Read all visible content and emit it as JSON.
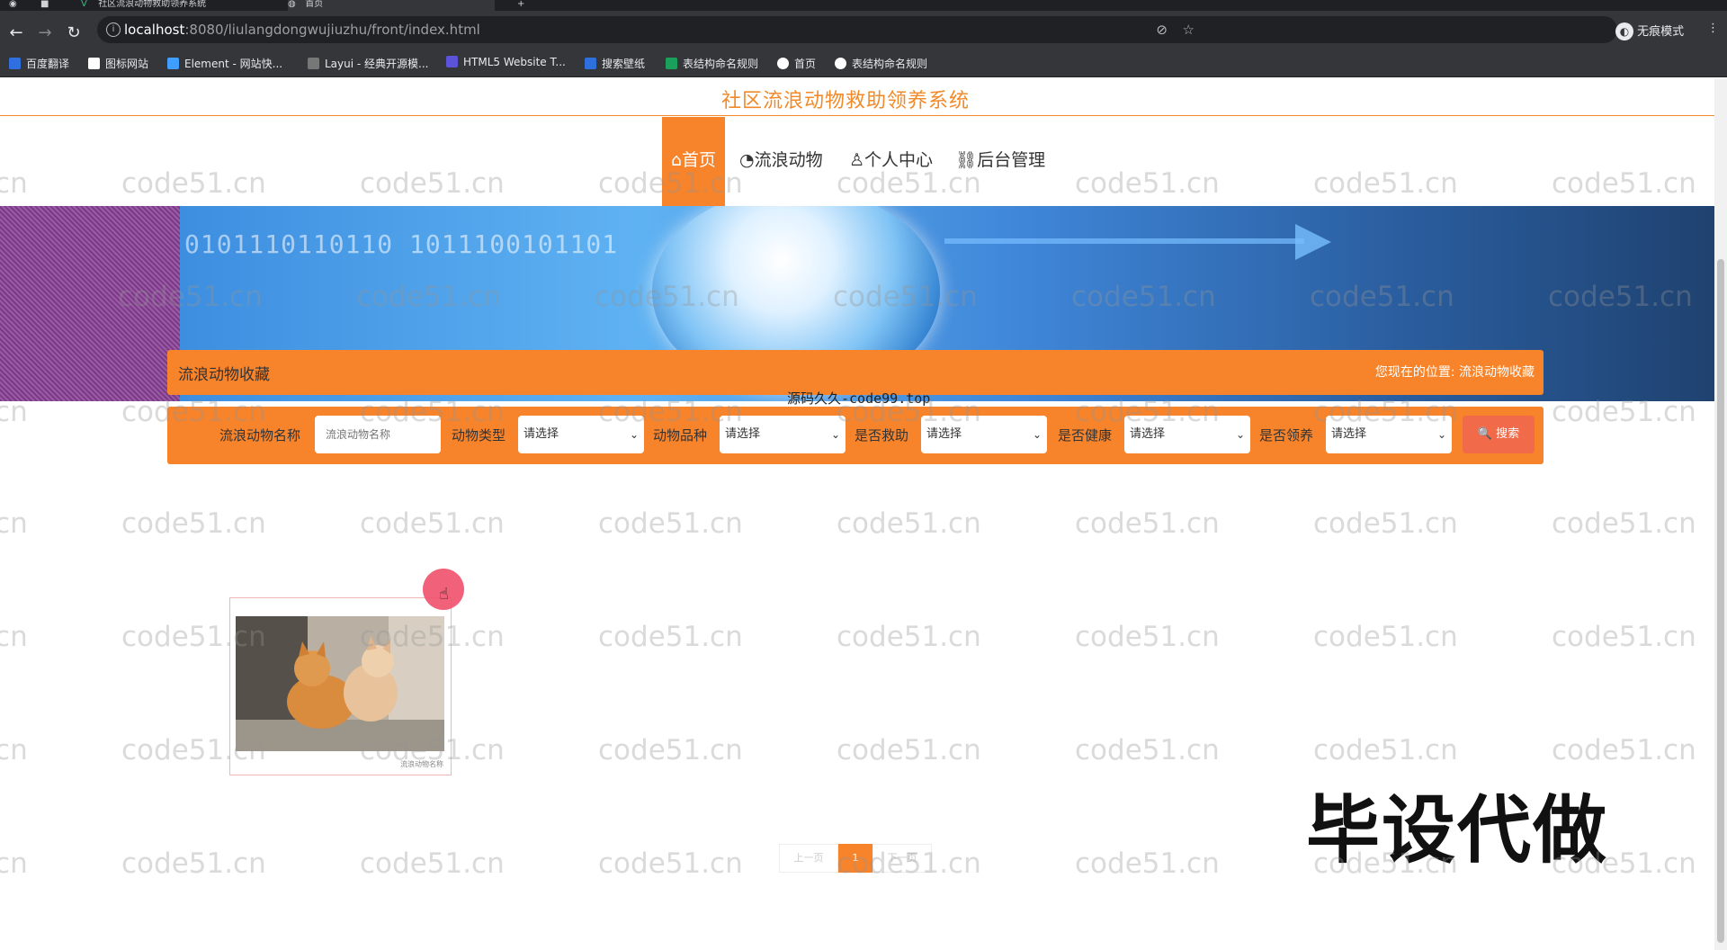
{
  "browser": {
    "tabs": [
      {
        "label": "社区流浪动物救助领养系统"
      },
      {
        "label": "首页"
      }
    ],
    "url_host": "localhost",
    "url_path": ":8080/liulangdongwujiuzhu/front/index.html",
    "profile_label": "无痕模式",
    "bookmarks": [
      {
        "label": "百度翻译",
        "color": "#2f6fe0"
      },
      {
        "label": "图标网站",
        "color": "#ffffff"
      },
      {
        "label": "Element - 网站快...",
        "color": "#409eff"
      },
      {
        "label": "Layui - 经典开源模...",
        "color": "#ffffff"
      },
      {
        "label": "HTML5 Website T...",
        "color": "#5b53d8"
      },
      {
        "label": "搜索壁纸",
        "color": "#2d6fdd"
      },
      {
        "label": "表结构命名规则",
        "color": "#1aa05a"
      },
      {
        "label": "首页",
        "color": "#ffffff"
      },
      {
        "label": "表结构命名规则",
        "color": "#ffffff"
      }
    ]
  },
  "site": {
    "title": "社区流浪动物救助领养系统",
    "nav": [
      {
        "label": "⌂首页",
        "active": true
      },
      {
        "label": "◔流浪动物"
      },
      {
        "label": "♙个人中心"
      },
      {
        "label": "⛓后台管理"
      }
    ],
    "banner_digits": "0101110110110   1011100101101",
    "accent_color": "#f7832a"
  },
  "section": {
    "title": "流浪动物收藏",
    "location_label": "您现在的位置: 流浪动物收藏"
  },
  "overlay_watermark": "源码久久-code99.top",
  "search": {
    "name_label": "流浪动物名称",
    "name_placeholder": "流浪动物名称",
    "type_label": "动物类型",
    "breed_label": "动物品种",
    "rescue_label": "是否救助",
    "health_label": "是否健康",
    "adopt_label": "是否领养",
    "select_placeholder": "请选择",
    "button_label": "🔍 搜索"
  },
  "card": {
    "caption": "流浪动物名称"
  },
  "pager": {
    "prev": "上一页",
    "current": "1",
    "next": "下一页"
  },
  "promo_text": "毕设代做",
  "watermark_text": "code51.cn"
}
